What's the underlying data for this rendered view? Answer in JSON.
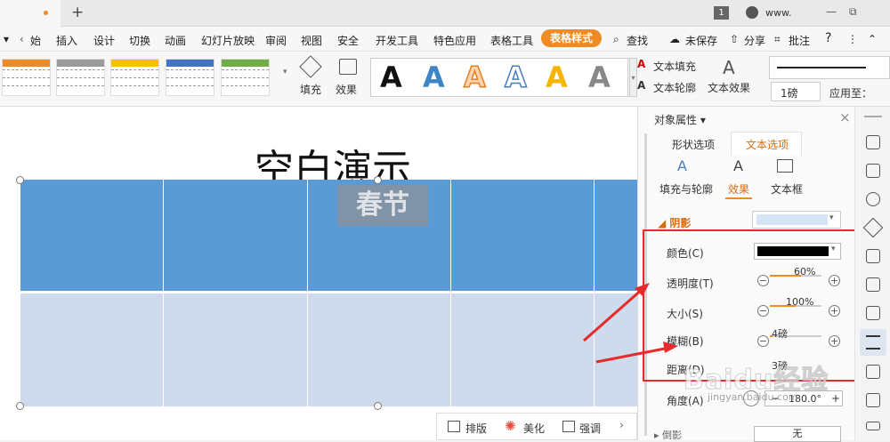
{
  "title_bar": {
    "new_tab": "+",
    "page_badge": "1",
    "site": "www.",
    "minimize": "—",
    "restore": "⧉"
  },
  "menu": {
    "left_partial": "始",
    "items": [
      "插入",
      "设计",
      "切换",
      "动画",
      "幻灯片放映",
      "审阅",
      "视图",
      "安全",
      "开发工具",
      "特色应用",
      "表格工具"
    ],
    "active_tab": "表格样式",
    "find": "查找",
    "unsaved": "未保存",
    "share": "分享",
    "annotate": "批注",
    "help": "?"
  },
  "ribbon": {
    "fill_label": "填充",
    "effect_label": "效果",
    "glyph": "A",
    "text_fill": "文本填充",
    "text_outline": "文本轮廓",
    "text_effect": "文本效果",
    "weight": "1磅",
    "apply_to": "应用至："
  },
  "slide": {
    "title_partial": "空白演示",
    "cell_text": "春节"
  },
  "bottom_toolbar": {
    "layout": "排版",
    "beautify": "美化",
    "emphasize": "强调"
  },
  "panel": {
    "header": "对象属性",
    "tabs": [
      "形状选项",
      "文本选项"
    ],
    "subtabs": [
      "填充与轮廓",
      "效果",
      "文本框"
    ],
    "section": "阴影",
    "rows": [
      {
        "label": "颜色(C)"
      },
      {
        "label": "透明度(T)",
        "value": "60%",
        "level": 0.6
      },
      {
        "label": "大小(S)",
        "value": "100%",
        "level": 0.5
      },
      {
        "label": "模糊(B)",
        "value": "4磅",
        "level": 0.05
      },
      {
        "label": "距离(D)",
        "value": "3磅"
      },
      {
        "label": "角度(A)",
        "value": "180.0°"
      }
    ],
    "next_section": "倒影",
    "next_value": "无"
  },
  "colors": {
    "accent": "#f08a24",
    "cell_dark": "#5b9bd5",
    "cell_light": "#cfdbec",
    "annotation": "#e52b2b"
  },
  "watermark": {
    "brand": "Baidu经验",
    "url": "jingyan.baidu.com"
  }
}
